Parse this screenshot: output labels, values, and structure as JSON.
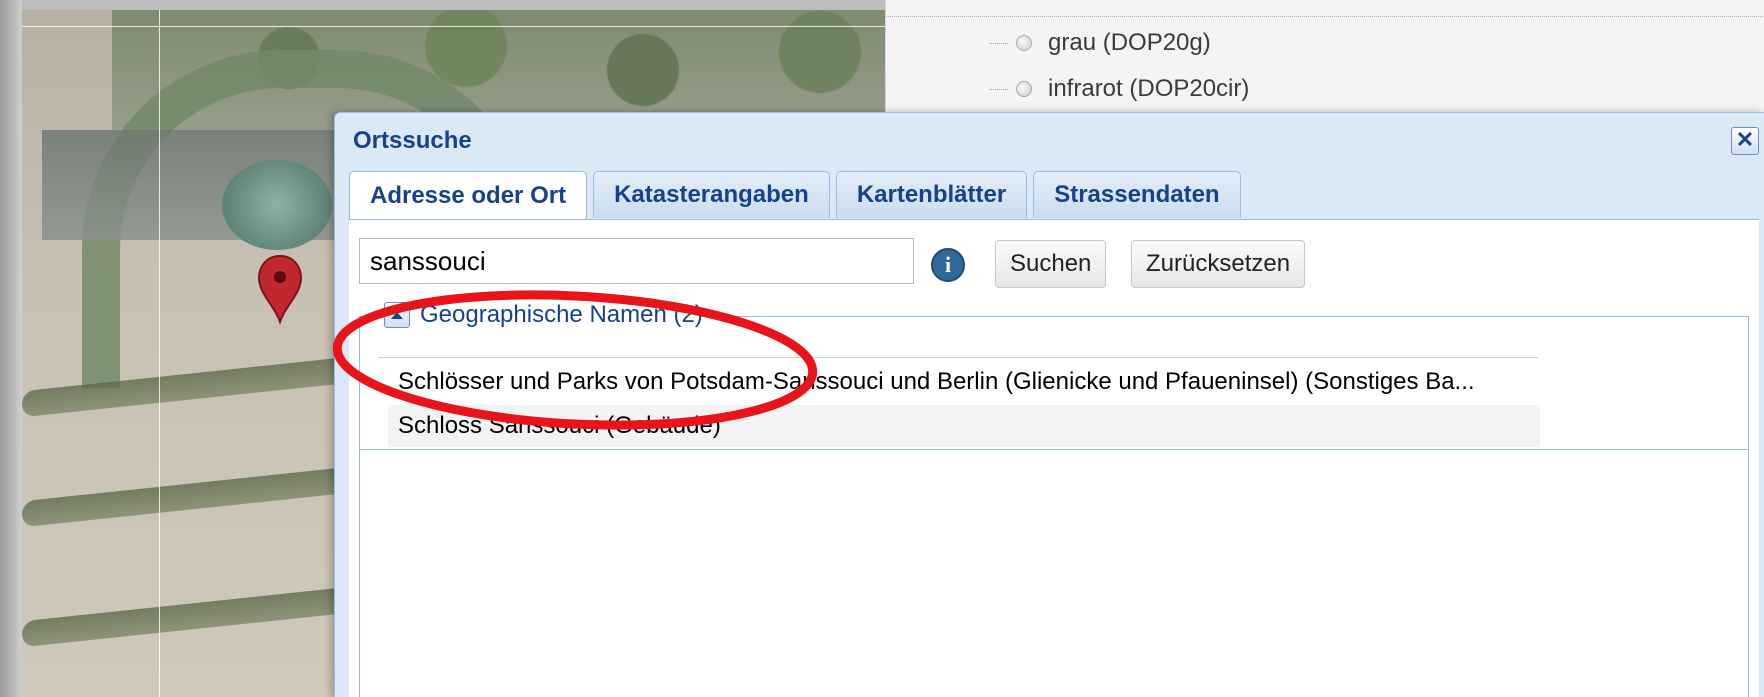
{
  "layers": {
    "items": [
      {
        "label": "grau (DOP20g)"
      },
      {
        "label": "infrarot (DOP20cir)"
      }
    ]
  },
  "dialog": {
    "title": "Ortssuche",
    "close_symbol": "✕",
    "tabs": [
      {
        "label": "Adresse oder Ort",
        "active": true
      },
      {
        "label": "Katasterangaben",
        "active": false
      },
      {
        "label": "Kartenblätter",
        "active": false
      },
      {
        "label": "Strassendaten",
        "active": false
      }
    ],
    "search": {
      "value": "sanssouci",
      "placeholder": "",
      "info_symbol": "i",
      "search_button": "Suchen",
      "reset_button": "Zurücksetzen"
    },
    "results": {
      "group_label": "Geographische Namen (2)",
      "rows": [
        {
          "label": "Schlösser und Parks von Potsdam-Sanssouci und Berlin (Glienicke und Pfaueninsel) (Sonstiges Ba..."
        },
        {
          "label": "Schloss Sanssouci (Gebäude)"
        }
      ]
    }
  },
  "colors": {
    "accent": "#15428b",
    "border": "#99bbe8",
    "annotation": "#e8141a",
    "pin": "#c0282d"
  }
}
